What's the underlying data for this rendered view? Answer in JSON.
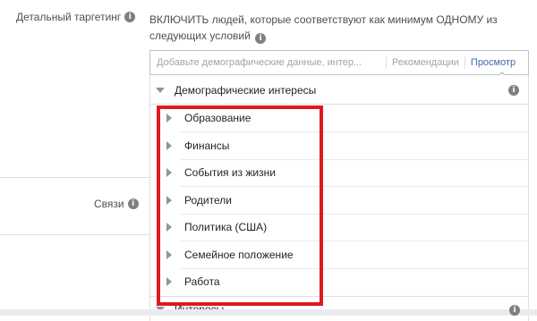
{
  "targeting": {
    "label": "Детальный таргетинг",
    "description": "ВКЛЮЧИТЬ людей, которые соответствуют как минимум ОДНОМУ из следующих условий"
  },
  "search": {
    "placeholder": "Добавьте демографические данные, интер...",
    "recommendations": "Рекомендации",
    "browse": "Просмотр"
  },
  "dropdown": {
    "category": "Демографические интересы",
    "items": [
      {
        "label": "Образование"
      },
      {
        "label": "Финансы"
      },
      {
        "label": "События из жизни"
      },
      {
        "label": "Родители"
      },
      {
        "label": "Политика (США)"
      },
      {
        "label": "Семейное положение"
      },
      {
        "label": "Работа"
      }
    ],
    "next_category": "Интересы"
  },
  "connections": {
    "label": "Связи"
  },
  "colors": {
    "highlight_border": "#e0191f",
    "link_blue": "#4267b2"
  }
}
